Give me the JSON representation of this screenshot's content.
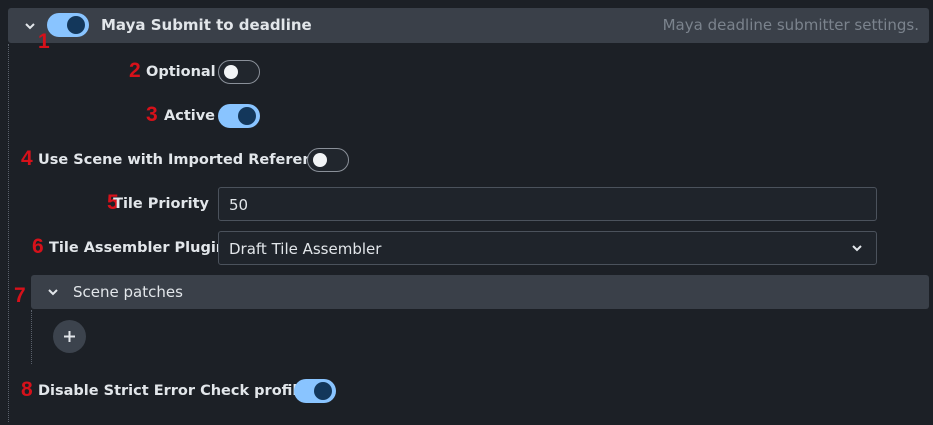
{
  "annotations": [
    "1",
    "2",
    "3",
    "4",
    "5",
    "6",
    "7",
    "8"
  ],
  "header": {
    "title": "Maya Submit to deadline",
    "description": "Maya deadline submitter settings.",
    "enabled": true
  },
  "fields": {
    "optional": {
      "label": "Optional",
      "value": false
    },
    "active": {
      "label": "Active",
      "value": true
    },
    "use_scene": {
      "label": "Use Scene with Imported Reference",
      "value": false
    },
    "tile_priority": {
      "label": "Tile Priority",
      "value": "50"
    },
    "tile_assembler": {
      "label": "Tile Assembler Plugin",
      "value": "Draft Tile Assembler"
    },
    "scene_patches": {
      "label": "Scene patches",
      "add_label": "+"
    },
    "strict_error": {
      "label": "Disable Strict Error Check profiles",
      "value": true
    }
  },
  "colors": {
    "toggle_on": "#89c4ff",
    "annotation": "#d6111a",
    "header_bg": "#3a4049"
  }
}
